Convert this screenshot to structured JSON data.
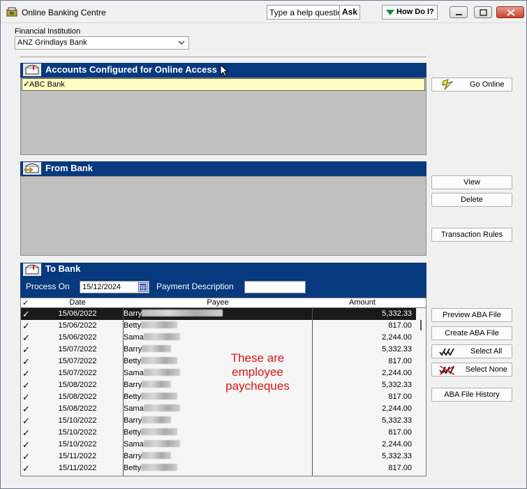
{
  "window": {
    "title": "Online Banking Centre",
    "help_placeholder": "Type a help question",
    "ask_label": "Ask",
    "howdo_label": "How Do I?"
  },
  "institution": {
    "label": "Financial Institution",
    "selected": "ANZ Grindlays Bank"
  },
  "accounts_panel": {
    "title": "Accounts Configured for Online Access",
    "items": [
      {
        "label": "ABC Bank",
        "checked": true
      }
    ]
  },
  "from_bank_panel": {
    "title": "From Bank"
  },
  "to_bank_panel": {
    "title": "To Bank",
    "process_on_label": "Process On",
    "process_on_value": "15/12/2024",
    "payment_description_label": "Payment Description",
    "payment_description_value": ""
  },
  "buttons": {
    "go_online": "Go Online",
    "view": "View",
    "delete": "Delete",
    "transaction_rules": "Transaction Rules",
    "preview_aba": "Preview ABA File",
    "create_aba": "Create ABA File",
    "select_all": "Select All",
    "select_none": "Select None",
    "aba_history": "ABA File History"
  },
  "table": {
    "columns": [
      "Date",
      "Payee",
      "Amount"
    ],
    "rows": [
      {
        "checked": true,
        "date": "15/06/2022",
        "payee": "Barry",
        "amount": "5,332.33",
        "selected": true
      },
      {
        "checked": true,
        "date": "15/06/2022",
        "payee": "Betty",
        "amount": "817.00"
      },
      {
        "checked": true,
        "date": "15/06/2022",
        "payee": "Sama",
        "amount": "2,244.00"
      },
      {
        "checked": true,
        "date": "15/07/2022",
        "payee": "Barry",
        "amount": "5,332.33"
      },
      {
        "checked": true,
        "date": "15/07/2022",
        "payee": "Betty",
        "amount": "817.00"
      },
      {
        "checked": true,
        "date": "15/07/2022",
        "payee": "Sama",
        "amount": "2,244.00"
      },
      {
        "checked": true,
        "date": "15/08/2022",
        "payee": "Barry",
        "amount": "5,332.33"
      },
      {
        "checked": true,
        "date": "15/08/2022",
        "payee": "Betty",
        "amount": "817.00"
      },
      {
        "checked": true,
        "date": "15/08/2022",
        "payee": "Sama",
        "amount": "2,244.00"
      },
      {
        "checked": true,
        "date": "15/10/2022",
        "payee": "Barry",
        "amount": "5,332.33"
      },
      {
        "checked": true,
        "date": "15/10/2022",
        "payee": "Betty",
        "amount": "817.00"
      },
      {
        "checked": true,
        "date": "15/10/2022",
        "payee": "Sama",
        "amount": "2,244.00"
      },
      {
        "checked": true,
        "date": "15/11/2022",
        "payee": "Barry",
        "amount": "5,332.33"
      },
      {
        "checked": true,
        "date": "15/11/2022",
        "payee": "Betty",
        "amount": "817.00"
      }
    ]
  },
  "annotation": "These are employee paycheques",
  "colors": {
    "panel_header": "#06397d",
    "panel_body": "#c0c0c0",
    "selected_account": "#ffffc4",
    "annotation": "#d41818"
  }
}
